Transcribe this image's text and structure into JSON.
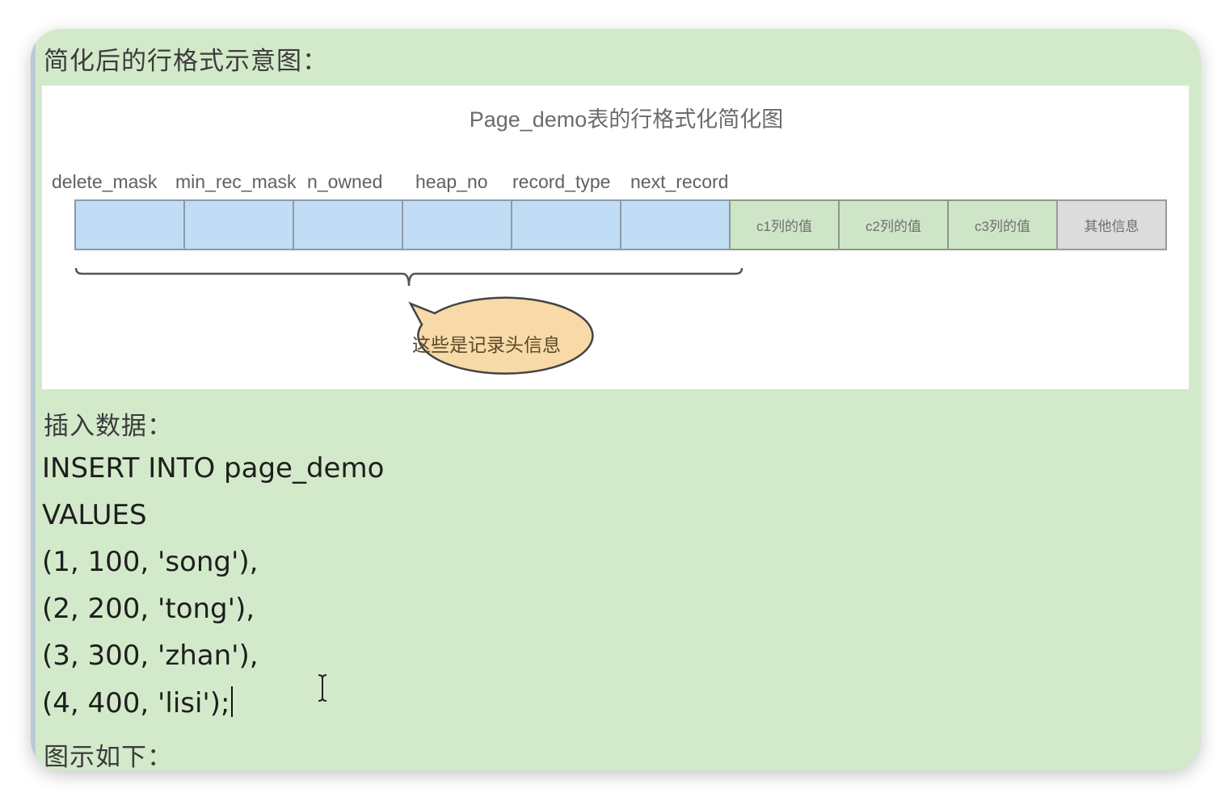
{
  "section_title_1": "简化后的行格式示意图：",
  "figure": {
    "title": "Page_demo表的行格式化简化图",
    "header_fields": [
      "delete_mask",
      "min_rec_mask",
      "n_owned",
      "heap_no",
      "record_type",
      "next_record"
    ],
    "value_cells": [
      "c1列的值",
      "c2列的值",
      "c3列的值"
    ],
    "other_cell": "其他信息",
    "callout": "这些是记录头信息",
    "colors": {
      "header_cell": "#c1dcf5",
      "value_cell": "#cfe5c8",
      "other_cell": "#dcdcdc",
      "callout_fill": "#f8d9a8"
    }
  },
  "section_title_2": "插入数据：",
  "sql": {
    "line1": "INSERT INTO page_demo",
    "line2": "VALUES",
    "rows": [
      "(1, 100, 'song'),",
      "(2, 200, 'tong'),",
      "(3, 300, 'zhan'),",
      "(4, 400, 'lisi');"
    ]
  },
  "section_title_3": "图示如下：",
  "background_color": "#d3eaca"
}
